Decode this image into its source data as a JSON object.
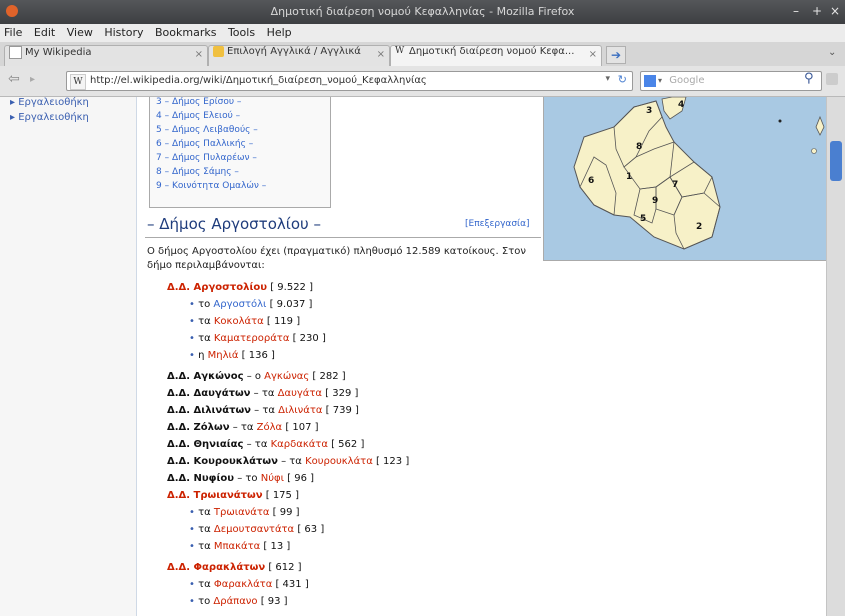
{
  "window": {
    "title": "Δημοτική διαίρεση νομού Κεφαλληνίας - Mozilla Firefox",
    "controls": [
      "–",
      "+",
      "×"
    ]
  },
  "menu": [
    "File",
    "Edit",
    "View",
    "History",
    "Bookmarks",
    "Tools",
    "Help"
  ],
  "tabs": [
    {
      "label": "My Wikipedia"
    },
    {
      "label": "Επιλογή Αγγλικά / Αγγλικά"
    },
    {
      "label": "Δημοτική διαίρεση νομού Κεφα..."
    }
  ],
  "url": "http://el.wikipedia.org/wiki/Δημοτική_διαίρεση_νομού_Κεφαλληνίας",
  "search": {
    "placeholder": "Google",
    "engine_icon": "google-icon"
  },
  "sidebar": {
    "items": [
      "Εργαλειοθήκη",
      "Εργαλειοθήκη"
    ]
  },
  "toc": [
    "3 – Δήμος Ερίσου –",
    "4 – Δήμος Ελειού –",
    "5 – Δήμος Λειβαθούς –",
    "6 – Δήμος Παλλικής –",
    "7 – Δήμος Πυλαρέων –",
    "8 – Δήμος Σάμης –",
    "9 – Κοινότητα Ομαλών –"
  ],
  "map_labels": [
    "1",
    "2",
    "3",
    "4",
    "5",
    "6",
    "7",
    "8",
    "9"
  ],
  "section": {
    "title": "Δήμος Αργοστολίου",
    "edit": "[Επεξεργασία]"
  },
  "paragraph": "Ο δήμος Αργοστολίου έχει (πραγματικό) πληθυσμό 12.589 κατοίκους. Στον δήμο περιλαμβάνονται:",
  "list": [
    {
      "kind": "dd",
      "name": "Δ.Δ. Αργοστολίου",
      "red": true,
      "count": "[ 9.522 ]"
    },
    {
      "kind": "sub",
      "prefix": "το",
      "name": "Αργοστόλι",
      "count": "[ 9.037 ]"
    },
    {
      "kind": "sub",
      "prefix": "τα",
      "name": "Κοκολάτα",
      "count": "[ 119 ]"
    },
    {
      "kind": "sub",
      "prefix": "τα",
      "name": "Καματεροράτα",
      "count": "[ 230 ]"
    },
    {
      "kind": "sub",
      "prefix": "η",
      "name": "Μηλιά",
      "count": "[ 136 ]"
    },
    {
      "kind": "dd",
      "name": "Δ.Δ. Αγκώνος",
      "sep": "–",
      "prefix": "ο",
      "place": "Αγκώνας",
      "count": "[ 282 ]"
    },
    {
      "kind": "dd",
      "name": "Δ.Δ. Δαυγάτων",
      "sep": "–",
      "prefix": "τα",
      "place": "Δαυγάτα",
      "count": "[ 329 ]"
    },
    {
      "kind": "dd",
      "name": "Δ.Δ. Διλινάτων",
      "sep": "–",
      "prefix": "τα",
      "place": "Διλινάτα",
      "count": "[ 739 ]"
    },
    {
      "kind": "dd",
      "name": "Δ.Δ. Ζόλων",
      "sep": "–",
      "prefix": "τα",
      "place": "Ζόλα",
      "count": "[ 107 ]"
    },
    {
      "kind": "dd",
      "name": "Δ.Δ. Θηνιαίας",
      "sep": "–",
      "prefix": "τα",
      "place": "Καρδακάτα",
      "count": "[ 562 ]"
    },
    {
      "kind": "dd",
      "name": "Δ.Δ. Κουρουκλάτων",
      "sep": "–",
      "prefix": "τα",
      "place": "Κουρουκλάτα",
      "count": "[ 123 ]"
    },
    {
      "kind": "dd",
      "name": "Δ.Δ. Νυφίου",
      "sep": "–",
      "prefix": "το",
      "place": "Νύφι",
      "count": "[ 96 ]"
    },
    {
      "kind": "dd",
      "name": "Δ.Δ. Τρωιανάτων",
      "red": true,
      "count": "[ 175 ]"
    },
    {
      "kind": "sub",
      "prefix": "τα",
      "name": "Τρωιανάτα",
      "count": "[ 99 ]"
    },
    {
      "kind": "sub",
      "prefix": "τα",
      "name": "Δεμουτσαντάτα",
      "count": "[ 63 ]"
    },
    {
      "kind": "sub",
      "prefix": "τα",
      "name": "Μπακάτα",
      "count": "[ 13 ]"
    },
    {
      "kind": "dd",
      "name": "Δ.Δ. Φαρακλάτων",
      "red": true,
      "count": "[ 612 ]"
    },
    {
      "kind": "sub",
      "prefix": "τα",
      "name": "Φαρακλάτα",
      "count": "[ 431 ]"
    },
    {
      "kind": "sub",
      "prefix": "το",
      "name": "Δράπανο",
      "count": "[ 93 ]"
    }
  ]
}
